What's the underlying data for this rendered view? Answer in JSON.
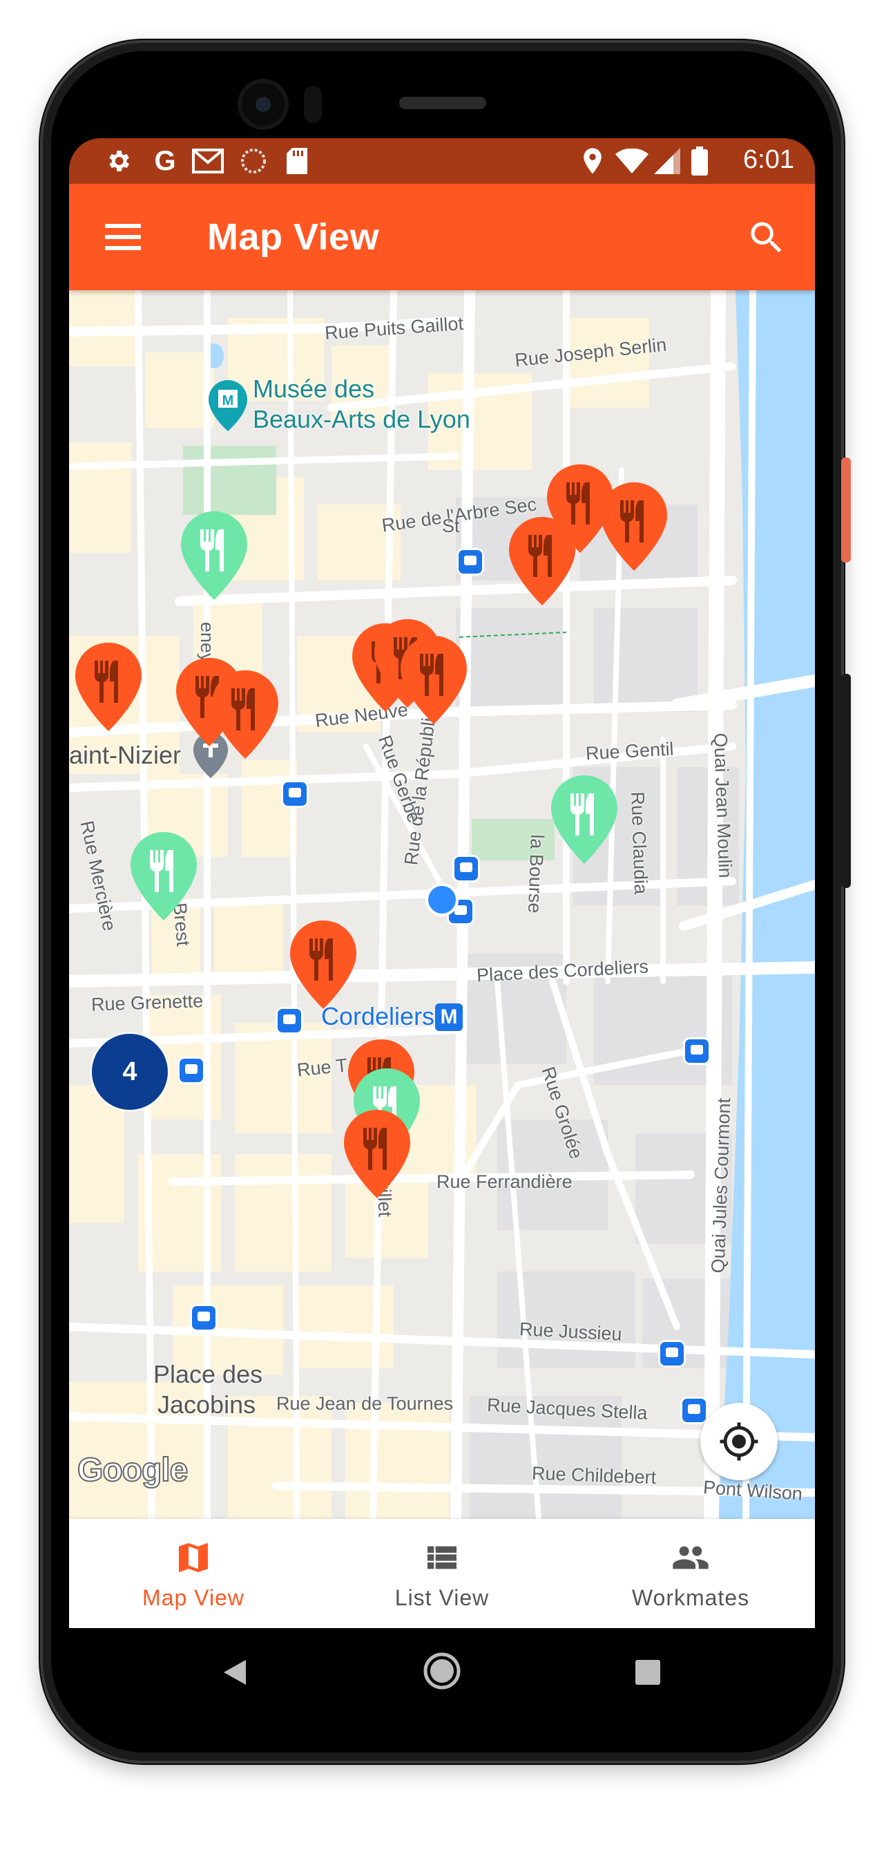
{
  "status_bar": {
    "time": "6:01",
    "left_icons": [
      "settings-icon",
      "google-icon",
      "gmail-icon",
      "photos-icon",
      "sd-card-icon"
    ],
    "right_icons": [
      "location-icon",
      "wifi-icon",
      "signal-icon",
      "battery-icon"
    ]
  },
  "app_bar": {
    "title": "Map View",
    "menu_icon": "menu-icon",
    "search_icon": "search-icon"
  },
  "map": {
    "streets": {
      "puits_gaillot": "Rue Puits Gaillot",
      "joseph_serlin": "Rue Joseph Serlin",
      "arbre_sec": "Rue de l'Arbre Sec",
      "neuve": "Rue Neuve",
      "gentil": "Rue Gentil",
      "republique": "Rue de la République",
      "gerbe": "Rue Gerbe",
      "merciere": "Rue Mercière",
      "brest": "Brest",
      "la_bourse": "la Bourse",
      "claudia": "Rue Claudia",
      "quai_jean_moulin": "Quai Jean Moulin",
      "cordeliers_place": "Place des Cordeliers",
      "grenette": "Rue Grenette",
      "rue_t": "Rue T",
      "grolee": "Rue Grolée",
      "ferrandiere": "Rue Ferrandière",
      "grillet": "Grillet",
      "quai_jules_courmont": "Quai Jules Courmont",
      "jussieu": "Rue Jussieu",
      "jean_de_tournes": "Rue Jean de Tournes",
      "jacques_stella": "Rue Jacques Stella",
      "childebert": "Rue Childebert",
      "pont_wilson": "Pont Wilson",
      "eney": "eney",
      "st": "St"
    },
    "places": {
      "musee_line1": "Musée des",
      "musee_line2": "Beaux-Arts de Lyon",
      "saint_nizier": "aint-Nizier",
      "jacobins_line1": "Place des",
      "jacobins_line2": "Jacobins",
      "cordeliers_metro": "Cordeliers",
      "metro_letter": "M"
    },
    "cluster_count": "4",
    "google_logo": "Google",
    "colors": {
      "restaurant_pin": "#ff5722",
      "joined_pin": "#6ee6a8",
      "water": "#aadaff",
      "park": "#c8e6c9"
    }
  },
  "bottom_nav": {
    "items": [
      {
        "label": "Map View",
        "icon": "map-icon",
        "active": true
      },
      {
        "label": "List View",
        "icon": "list-icon",
        "active": false
      },
      {
        "label": "Workmates",
        "icon": "people-icon",
        "active": false
      }
    ]
  },
  "system_nav": [
    "back-icon",
    "home-icon",
    "recents-icon"
  ]
}
